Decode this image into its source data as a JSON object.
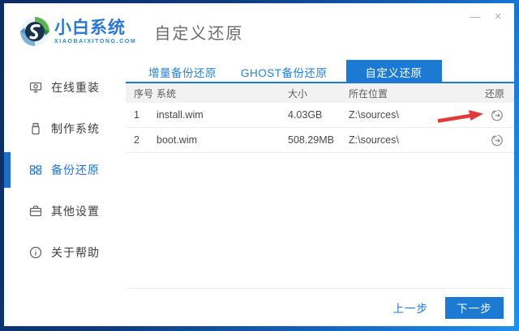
{
  "window": {
    "brand": {
      "name": "小白系统",
      "domain": "XIAOBAIXITONG.COM"
    },
    "title": "自定义还原",
    "controls": {
      "minimize": "—",
      "close": "×"
    }
  },
  "sidebar": {
    "items": [
      {
        "label": "在线重装",
        "icon": "monitor-icon",
        "active": false
      },
      {
        "label": "制作系统",
        "icon": "usb-drive-icon",
        "active": false
      },
      {
        "label": "备份还原",
        "icon": "apps-grid-icon",
        "active": true
      },
      {
        "label": "其他设置",
        "icon": "briefcase-icon",
        "active": false
      },
      {
        "label": "关于帮助",
        "icon": "info-icon",
        "active": false
      }
    ]
  },
  "tabs": [
    {
      "label": "增量备份还原",
      "active": false
    },
    {
      "label": "GHOST备份还原",
      "active": false
    },
    {
      "label": "自定义还原",
      "active": true
    }
  ],
  "table": {
    "headers": {
      "index": "序号",
      "system": "系统",
      "size": "大小",
      "location": "所在位置",
      "restore": "还原"
    },
    "rows": [
      {
        "index": "1",
        "system": "install.wim",
        "size": "4.03GB",
        "location": "Z:\\sources\\"
      },
      {
        "index": "2",
        "system": "boot.wim",
        "size": "508.29MB",
        "location": "Z:\\sources\\"
      }
    ]
  },
  "footer": {
    "prev_label": "上一步",
    "next_label": "下一步"
  },
  "colors": {
    "accent": "#1c7ad3",
    "border_dark": "#0b2d62",
    "border_light": "#1e90f0",
    "annotation_red": "#e03a3a"
  },
  "annotation": {
    "type": "red-arrow",
    "points_to": "restore-button-row-1"
  }
}
